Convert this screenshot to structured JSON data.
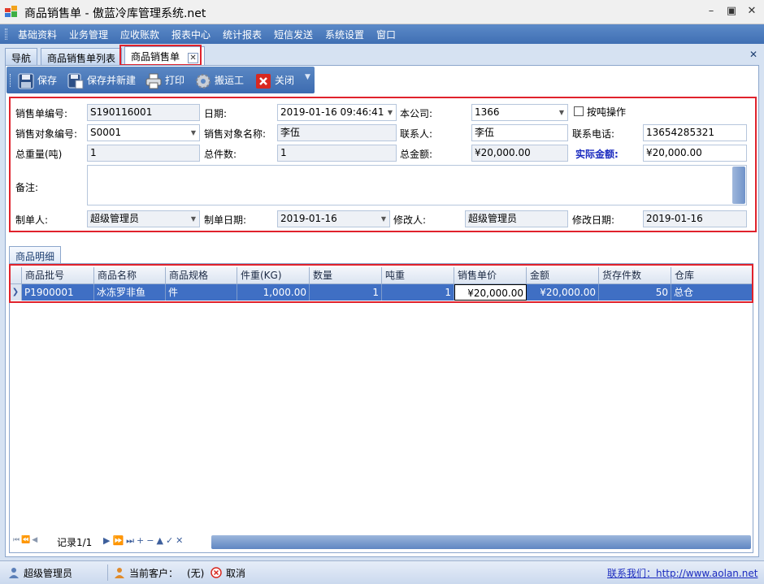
{
  "window": {
    "title": "商品销售单 - 傲蓝冷库管理系统.net"
  },
  "menu": [
    "基础资料",
    "业务管理",
    "应收账款",
    "报表中心",
    "统计报表",
    "短信发送",
    "系统设置",
    "窗口"
  ],
  "tabs": [
    {
      "label": "导航"
    },
    {
      "label": "商品销售单列表"
    },
    {
      "label": "商品销售单",
      "active": true
    }
  ],
  "toolbar": {
    "save": "保存",
    "save_new": "保存并新建",
    "print": "打印",
    "porter": "搬运工",
    "close": "关闭"
  },
  "form": {
    "order_no_label": "销售单编号:",
    "order_no": "S190116001",
    "date_label": "日期:",
    "date": "2019-01-16  09:46:41",
    "company_label": "本公司:",
    "company": "1366",
    "by_ton_label": "按吨操作",
    "by_ton_checked": false,
    "target_code_label": "销售对象编号:",
    "target_code": "S0001",
    "target_name_label": "销售对象名称:",
    "target_name": "李伍",
    "contact_label": "联系人:",
    "contact": "李伍",
    "phone_label": "联系电话:",
    "phone": "13654285321",
    "total_weight_label": "总重量(吨)",
    "total_weight": "1",
    "total_pieces_label": "总件数:",
    "total_pieces": "1",
    "total_amount_label": "总金额:",
    "total_amount": "¥20,000.00",
    "actual_amount_label": "实际金额:",
    "actual_amount": "¥20,000.00",
    "remark_label": "备注:",
    "remark": "",
    "creator_label": "制单人:",
    "creator": "超级管理员",
    "create_date_label": "制单日期:",
    "create_date": "2019-01-16",
    "modifier_label": "修改人:",
    "modifier": "超级管理员",
    "modify_date_label": "修改日期:",
    "modify_date": "2019-01-16"
  },
  "detail_tab": "商品明细",
  "grid": {
    "columns": [
      "商品批号",
      "商品名称",
      "商品规格",
      "件重(KG)",
      "数量",
      "吨重",
      "销售单价",
      "金额",
      "货存件数",
      "仓库"
    ],
    "rows": [
      [
        "P1900001",
        "冰冻罗非鱼",
        "件",
        "1,000.00",
        "1",
        "1",
        "¥20,000.00",
        "¥20,000.00",
        "50",
        "总仓"
      ]
    ]
  },
  "navigator": {
    "record": "记录1/1"
  },
  "statusbar": {
    "user": "超级管理员",
    "customer_label": "当前客户：",
    "customer": "(无)",
    "cancel": "取消",
    "contact_link": "联系我们：http://www.aolan.net"
  },
  "colors": {
    "accent": "#3f6fb3",
    "highlight": "#e0222c",
    "selected_row": "#3f6fc4"
  }
}
